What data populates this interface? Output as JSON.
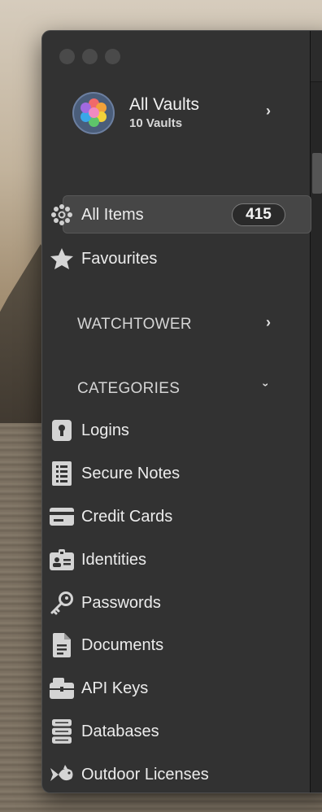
{
  "vault": {
    "title": "All Vaults",
    "subtitle": "10 Vaults"
  },
  "all_items": {
    "label": "All Items",
    "count": "415"
  },
  "favourites": {
    "label": "Favourites"
  },
  "sections": {
    "watchtower": "WATCHTOWER",
    "categories": "CATEGORIES"
  },
  "categories": [
    {
      "label": "Logins",
      "icon": "keyhole-icon"
    },
    {
      "label": "Secure Notes",
      "icon": "note-icon"
    },
    {
      "label": "Credit Cards",
      "icon": "credit-card-icon"
    },
    {
      "label": "Identities",
      "icon": "id-card-icon"
    },
    {
      "label": "Passwords",
      "icon": "key-icon"
    },
    {
      "label": "Documents",
      "icon": "document-icon"
    },
    {
      "label": "API Keys",
      "icon": "api-key-icon"
    },
    {
      "label": "Databases",
      "icon": "database-icon"
    },
    {
      "label": "Outdoor Licenses",
      "icon": "fish-icon"
    }
  ],
  "colors": {
    "sidebar": "#323232",
    "selected": "#464646",
    "text": "#ececec"
  }
}
